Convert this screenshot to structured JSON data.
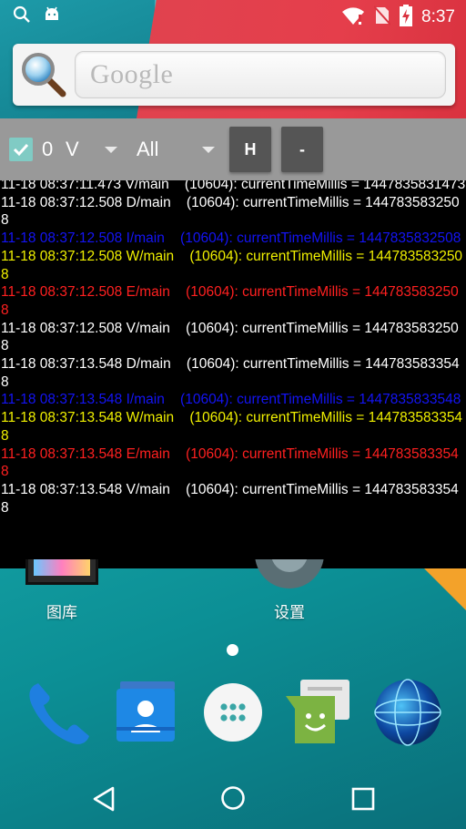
{
  "status_bar": {
    "time": "8:37",
    "icons": [
      "search-icon",
      "android-icon",
      "wifi-icon",
      "no-sim-icon",
      "battery-icon"
    ]
  },
  "search_widget": {
    "placeholder": "Google"
  },
  "log_controls": {
    "checkbox_checked": true,
    "count": "0",
    "level": "V",
    "filter": "All",
    "h_button": "H",
    "minus_button": "-"
  },
  "log_lines": [
    {
      "level": "V",
      "text": "11-18 08:37:11.473 V/main    (10604): currentTimeMillis = 1447835831473"
    },
    {
      "level": "D",
      "text": "11-18 08:37:12.508 D/main    (10604): currentTimeMillis = 1447835832508"
    },
    {
      "level": "I",
      "text": "11-18 08:37:12.508 I/main    (10604): currentTimeMillis = 1447835832508"
    },
    {
      "level": "W",
      "text": "11-18 08:37:12.508 W/main    (10604): currentTimeMillis = 1447835832508"
    },
    {
      "level": "E",
      "text": "11-18 08:37:12.508 E/main    (10604): currentTimeMillis = 1447835832508"
    },
    {
      "level": "V",
      "text": "11-18 08:37:12.508 V/main    (10604): currentTimeMillis = 1447835832508"
    },
    {
      "level": "D",
      "text": "11-18 08:37:13.548 D/main    (10604): currentTimeMillis = 1447835833548"
    },
    {
      "level": "I",
      "text": "11-18 08:37:13.548 I/main    (10604): currentTimeMillis = 1447835833548"
    },
    {
      "level": "W",
      "text": "11-18 08:37:13.548 W/main    (10604): currentTimeMillis = 1447835833548"
    },
    {
      "level": "E",
      "text": "11-18 08:37:13.548 E/main    (10604): currentTimeMillis = 1447835833548"
    },
    {
      "level": "V",
      "text": "11-18 08:37:13.548 V/main    (10604): currentTimeMillis = 1447835833548"
    }
  ],
  "home_apps": [
    {
      "label": "图库",
      "icon": "gallery-icon"
    },
    {
      "label": "设置",
      "icon": "settings-icon"
    }
  ],
  "dock": [
    "phone-icon",
    "contacts-icon",
    "app-drawer-icon",
    "messaging-icon",
    "browser-icon"
  ],
  "nav": [
    "back-icon",
    "home-icon",
    "recents-icon"
  ],
  "colors": {
    "log_verbose": "#ffffff",
    "log_info": "#1414f5",
    "log_warn": "#f0f000",
    "log_error": "#ff2020",
    "control_bar": "#999999",
    "checkbox": "#80cbc4"
  }
}
